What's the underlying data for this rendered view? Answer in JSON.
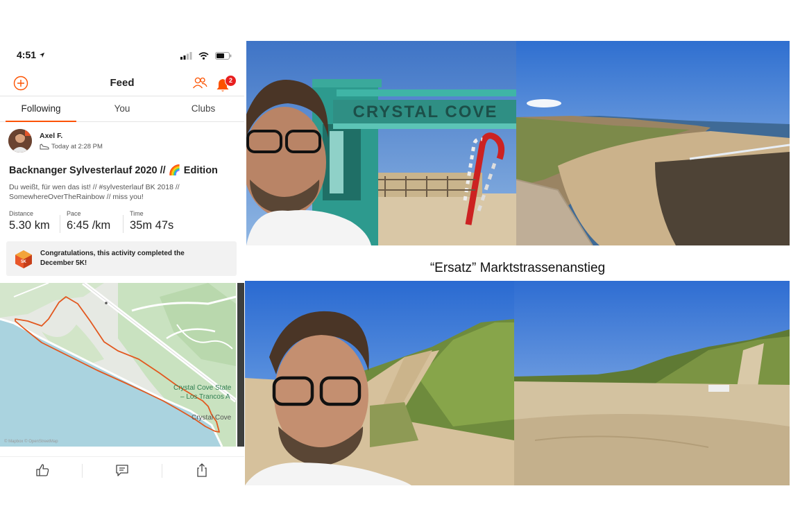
{
  "status_bar": {
    "time": "4:51"
  },
  "nav": {
    "title": "Feed",
    "notification_count": "2"
  },
  "tabs": [
    {
      "label": "Following"
    },
    {
      "label": "You"
    },
    {
      "label": "Clubs"
    }
  ],
  "post": {
    "athlete": "Axel F.",
    "posted": "Today at 2:28 PM",
    "title": "Backnanger Sylvesterlauf 2020 // 🌈 Edition",
    "description": "Du weißt, für wen das ist! // #sylvesterlauf BK 2018 // SomewhereOverTheRainbow // miss you!",
    "stats": [
      {
        "label": "Distance",
        "value": "5.30 km"
      },
      {
        "label": "Pace",
        "value": "6:45 /km"
      },
      {
        "label": "Time",
        "value": "35m 47s"
      }
    ],
    "achievement": {
      "text": "Congratulations, this activity completed the December 5K!",
      "icon_text": "5K"
    },
    "map": {
      "label_park_line1": "Crystal Cove State",
      "label_park_line2": "– Los Trancos A",
      "label_place": "Crystal Cove",
      "attribution": "© Mapbox © OpenStreetMap"
    }
  },
  "caption": "“Ersatz” Marktstrassenanstieg",
  "colors": {
    "accent": "#fc5200",
    "badge": "#e81f1f"
  },
  "icons": [
    "location-arrow-icon",
    "signal-icon",
    "wifi-icon",
    "battery-icon",
    "add-icon",
    "friends-icon",
    "bell-icon",
    "shoe-icon",
    "badge-5k-icon",
    "thumbs-up-icon",
    "comment-icon",
    "share-icon"
  ]
}
